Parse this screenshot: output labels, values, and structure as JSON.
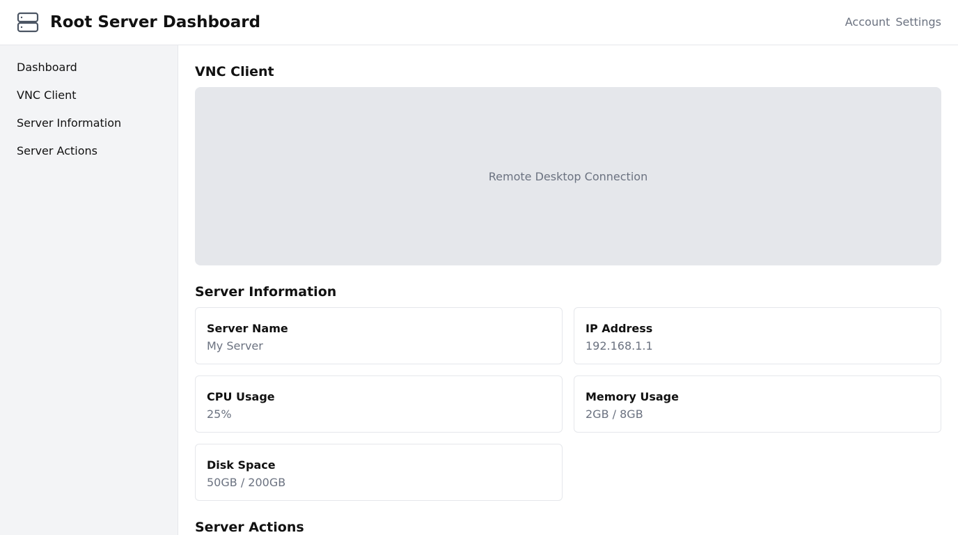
{
  "header": {
    "title": "Root Server Dashboard",
    "logo_icon": "server-stack-icon",
    "nav": [
      "Account",
      "Settings"
    ]
  },
  "sidebar": {
    "items": [
      {
        "label": "Dashboard"
      },
      {
        "label": "VNC Client"
      },
      {
        "label": "Server Information"
      },
      {
        "label": "Server Actions"
      }
    ]
  },
  "vnc": {
    "title": "VNC Client",
    "placeholder": "Remote Desktop Connection"
  },
  "server_info": {
    "title": "Server Information",
    "cards": [
      {
        "label": "Server Name",
        "value": "My Server"
      },
      {
        "label": "IP Address",
        "value": "192.168.1.1"
      },
      {
        "label": "CPU Usage",
        "value": "25%"
      },
      {
        "label": "Memory Usage",
        "value": "2GB / 8GB"
      },
      {
        "label": "Disk Space",
        "value": "50GB / 200GB"
      }
    ]
  },
  "server_actions": {
    "title": "Server Actions"
  },
  "colors": {
    "sidebar_bg": "#f3f4f6",
    "border": "#e5e7eb",
    "muted_text": "#6b7280",
    "vnc_bg": "#e5e7eb"
  }
}
